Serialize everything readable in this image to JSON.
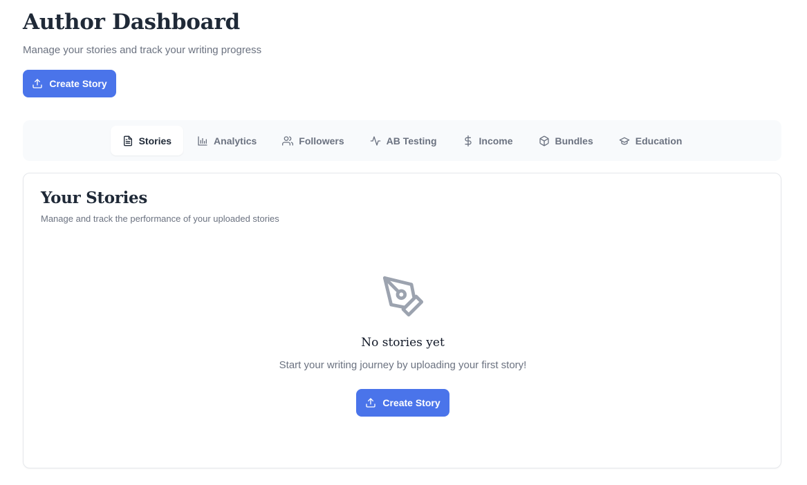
{
  "header": {
    "title": "Author Dashboard",
    "subtitle": "Manage your stories and track your writing progress",
    "create_label": "Create Story"
  },
  "tabs": [
    {
      "label": "Stories",
      "icon": "file-text-icon",
      "active": true
    },
    {
      "label": "Analytics",
      "icon": "bar-chart-icon",
      "active": false
    },
    {
      "label": "Followers",
      "icon": "users-icon",
      "active": false
    },
    {
      "label": "AB Testing",
      "icon": "activity-icon",
      "active": false
    },
    {
      "label": "Income",
      "icon": "dollar-icon",
      "active": false
    },
    {
      "label": "Bundles",
      "icon": "package-icon",
      "active": false
    },
    {
      "label": "Education",
      "icon": "graduation-cap-icon",
      "active": false
    }
  ],
  "stories": {
    "title": "Your Stories",
    "subtitle": "Manage and track the performance of your uploaded stories",
    "empty": {
      "icon": "pen-tool-icon",
      "title": "No stories yet",
      "text": "Start your writing journey by uploading your first story!",
      "button_label": "Create Story"
    }
  },
  "colors": {
    "primary": "#4a74ea",
    "muted_text": "#6b7280",
    "heading": "#1f2937",
    "tab_bar_bg": "#f8fafc",
    "empty_icon": "#9ca3af"
  }
}
